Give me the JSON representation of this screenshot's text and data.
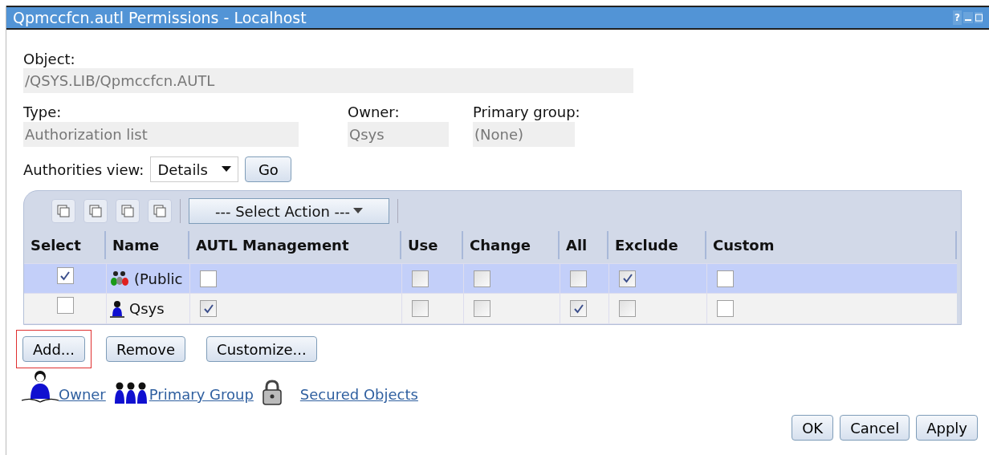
{
  "window": {
    "title": "Qpmccfcn.autl Permissions - Localhost",
    "help": "?"
  },
  "object": {
    "label": "Object:",
    "value": "/QSYS.LIB/Qpmccfcn.AUTL"
  },
  "fields": [
    {
      "label": "Type:",
      "value": "Authorization list"
    },
    {
      "label": "Owner:",
      "value": "Qsys"
    },
    {
      "label": "Primary group:",
      "value": "(None)"
    }
  ],
  "authorities_view": {
    "label": "Authorities view:",
    "value": "Details",
    "go": "Go"
  },
  "table": {
    "action_select": "--- Select Action ---",
    "columns": [
      "Select",
      "Name",
      "AUTL Management",
      "Use",
      "Change",
      "All",
      "Exclude",
      "Custom"
    ],
    "rows": [
      {
        "selected": true,
        "kind": "group",
        "name": "(Public",
        "autl": false,
        "use": false,
        "change": false,
        "all": false,
        "exclude": true,
        "custom": false
      },
      {
        "selected": false,
        "kind": "user",
        "name": "Qsys",
        "autl": true,
        "use": false,
        "change": false,
        "all": true,
        "exclude": false,
        "custom": false
      }
    ]
  },
  "buttons": [
    {
      "label": "Add...",
      "highlighted": true
    },
    {
      "label": "Remove",
      "highlighted": false
    },
    {
      "label": "Customize...",
      "highlighted": false
    }
  ],
  "links": [
    {
      "kind": "owner",
      "label": "Owner"
    },
    {
      "kind": "group",
      "label": "Primary Group"
    },
    {
      "kind": "lock",
      "label": "Secured Objects"
    }
  ],
  "footer_buttons": [
    "OK",
    "Cancel",
    "Apply"
  ]
}
